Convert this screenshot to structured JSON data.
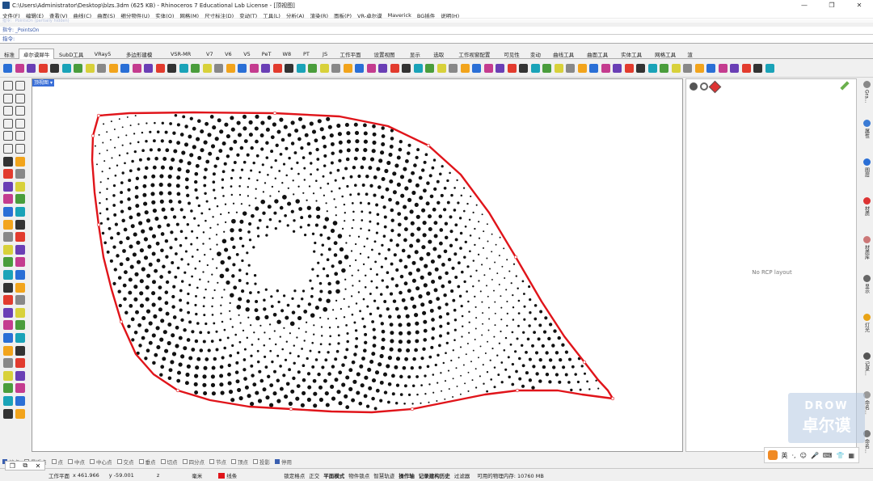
{
  "window": {
    "title": "C:\\Users\\Administrator\\Desktop\\blzs.3dm (625 KB) - Rhinoceros 7 Educational Lab License - [顶视图]",
    "minimize": "—",
    "maximize": "❐",
    "close": "✕"
  },
  "menu": [
    "文件(F)",
    "编辑(E)",
    "查看(V)",
    "曲线(C)",
    "曲面(S)",
    "细分物件(U)",
    "实体(O)",
    "网格(M)",
    "尺寸标注(D)",
    "变动(T)",
    "工具(L)",
    "分析(A)",
    "渲染(R)",
    "面板(P)",
    "VR-卓尔谟",
    "Maverick",
    "BG插件",
    "说明(H)"
  ],
  "command": {
    "history_partial": "指令: _PointsOn (partially hidden)",
    "history": "指令: _PointsOn",
    "prompt_label": "指令:",
    "input_value": ""
  },
  "tabs": [
    "标准",
    "卓尔谟犀牛",
    "SubD工具",
    "VRay5",
    "多边形建模",
    "VSR-MR",
    "V7",
    "V6",
    "V5",
    "PeT",
    "W8",
    "PT",
    "JS",
    "工作平面",
    "设置视图",
    "显示",
    "选取",
    "工作视窗配置",
    "可见性",
    "变动",
    "曲线工具",
    "曲面工具",
    "实体工具",
    "网格工具",
    "渲"
  ],
  "active_tab_index": 1,
  "viewport": {
    "label": "顶视图",
    "menu_arrow": "▾"
  },
  "right_panel": {
    "message": "No RCP layout"
  },
  "side_tabs": [
    "Gra...",
    "属性",
    "图层",
    "材质",
    "材质库",
    "显示",
    "灯光",
    "记录...",
    "命名...",
    "命名..."
  ],
  "osnap": {
    "items": [
      "端点",
      "最近点",
      "点",
      "中点",
      "中心点",
      "交点",
      "垂点",
      "切点",
      "四分点",
      "节点",
      "顶点",
      "投影",
      "停用"
    ],
    "checked": [
      true,
      false,
      false,
      false,
      false,
      false,
      false,
      false,
      false,
      false,
      false,
      false,
      true
    ]
  },
  "status": {
    "cplane": "工作平面",
    "x": "x 461.966",
    "y": "y -59.001",
    "z": "z",
    "units": "毫米",
    "layer": "线条",
    "layer_color": "#e0141a",
    "buttons": [
      "锁定格点",
      "正交",
      "平面模式",
      "物件锁点",
      "智慧轨迹",
      "操作轴",
      "记录建构历史",
      "过滤器"
    ],
    "bold": [
      false,
      false,
      true,
      false,
      false,
      true,
      true,
      false
    ],
    "memory": "可用的物理内存: 10760 MB"
  },
  "ime": {
    "lang": "英"
  },
  "watermark": {
    "line1": "DROW",
    "line2": "卓尔谟"
  },
  "mini_bar": {
    "icons": [
      "❐",
      "⧉",
      "✕"
    ]
  },
  "pattern": {
    "boundary_color": "#e0141a",
    "dot_color": "#111111",
    "rings": 36,
    "spiral_points": 2600
  }
}
